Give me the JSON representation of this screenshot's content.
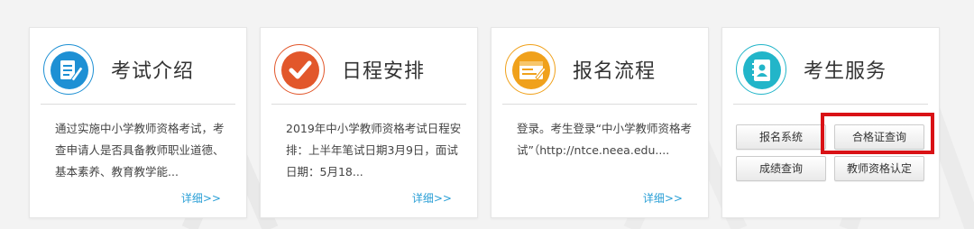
{
  "cards": [
    {
      "title": "考试介绍",
      "icon": "document-edit-icon",
      "desc": "通过实施中小学教师资格考试，考查申请人是否具备教师职业道德、基本素养、教育教学能...",
      "more": "详细>>"
    },
    {
      "title": "日程安排",
      "icon": "checkmark-icon",
      "desc": "2019年中小学教师资格考试日程安排：上半年笔试日期3月9日，面试日期：5月18...",
      "more": "详细>>"
    },
    {
      "title": "报名流程",
      "icon": "form-icon",
      "desc": "登录。考生登录“中小学教师资格考试”（http://ntce.neea.edu....",
      "more": "详细>>"
    },
    {
      "title": "考生服务",
      "icon": "contact-book-icon"
    }
  ],
  "services": [
    {
      "label": "报名系统"
    },
    {
      "label": "合格证查询"
    },
    {
      "label": "成绩查询"
    },
    {
      "label": "教师资格认定"
    }
  ],
  "colors": {
    "blue": "#1e90d4",
    "red": "#e2572b",
    "orange": "#f0a11b",
    "teal": "#22b5c9",
    "link": "#2a9fd6",
    "highlight": "#d91216"
  }
}
